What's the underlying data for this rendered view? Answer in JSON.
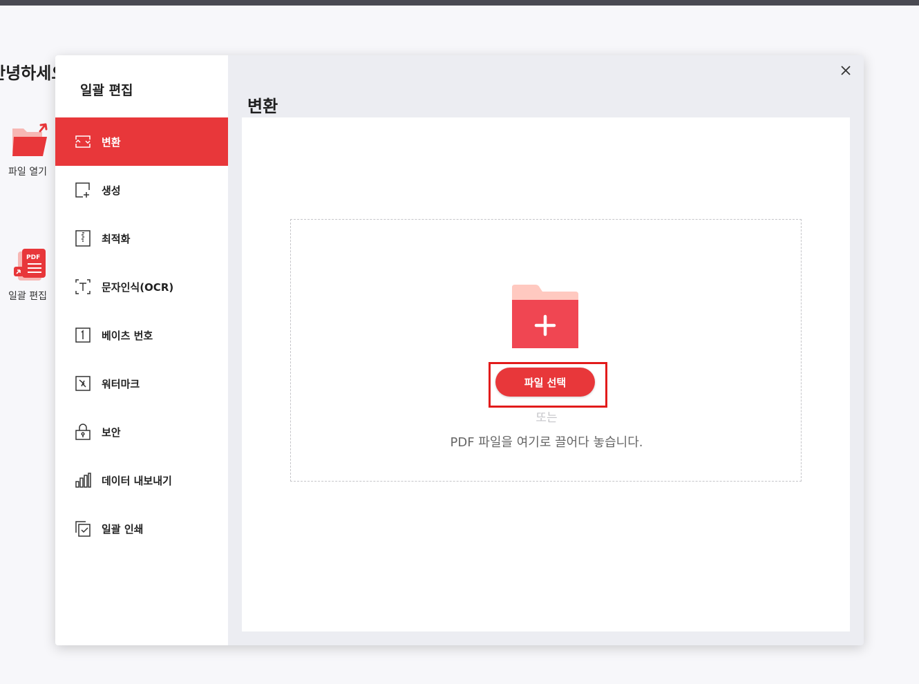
{
  "background": {
    "greeting": "안녕하세요",
    "items": [
      {
        "label": "파일 열기",
        "icon": "folder-open-icon"
      },
      {
        "label": "일괄 편집",
        "icon": "pdf-batch-icon"
      }
    ]
  },
  "dialog": {
    "sidebar_title": "일괄 편집",
    "menu": [
      {
        "label": "변환",
        "icon": "convert-icon",
        "active": true
      },
      {
        "label": "생성",
        "icon": "create-icon"
      },
      {
        "label": "최적화",
        "icon": "optimize-icon"
      },
      {
        "label": "문자인식(OCR)",
        "icon": "ocr-icon"
      },
      {
        "label": "베이츠 번호",
        "icon": "bates-number-icon"
      },
      {
        "label": "워터마크",
        "icon": "watermark-icon"
      },
      {
        "label": "보안",
        "icon": "lock-icon"
      },
      {
        "label": "데이터 내보내기",
        "icon": "bar-chart-icon"
      },
      {
        "label": "일괄 인쇄",
        "icon": "print-icon"
      }
    ],
    "main_title": "변환",
    "dropzone": {
      "select_button": "파일 선택",
      "or": "또는",
      "hint": "PDF 파일을 여기로 끌어다 놓습니다."
    },
    "close_icon": "close-icon",
    "colors": {
      "accent": "#e8373a",
      "highlight_frame": "#e21b1b"
    }
  }
}
